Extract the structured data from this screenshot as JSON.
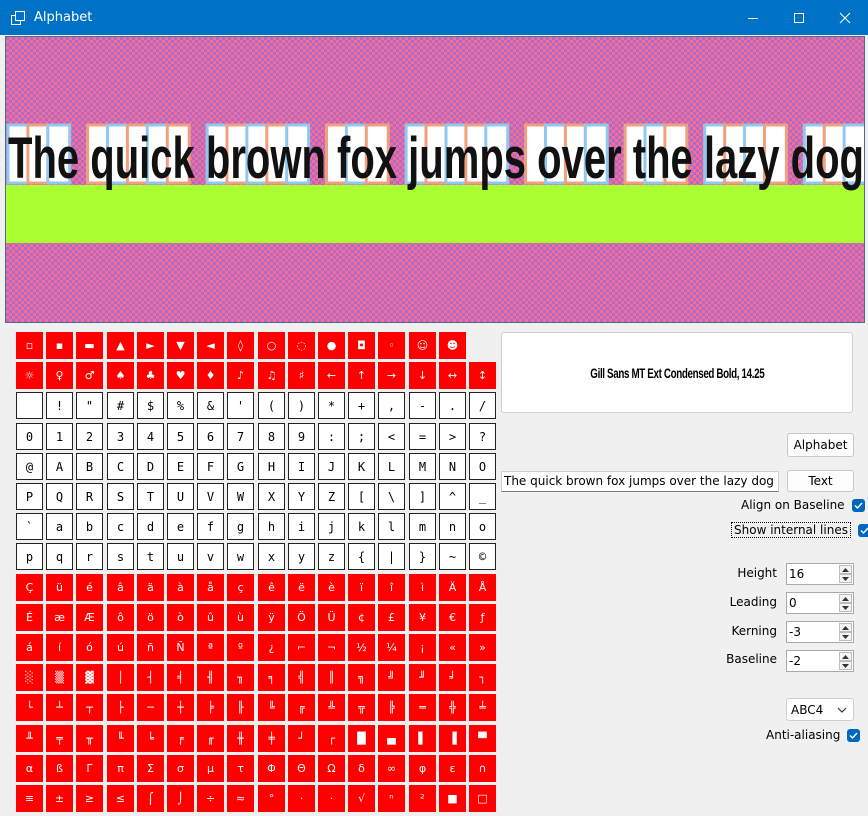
{
  "window": {
    "title": "Alphabet",
    "app_icon": "window-icon",
    "controls": [
      "minimize-icon",
      "maximize-icon",
      "close-icon"
    ]
  },
  "preview": {
    "sample_text": "The quick brown fox jumps over the lazy dog",
    "colors": {
      "checker_a": "#a66dd0",
      "checker_b": "#ff6b8c",
      "baseline_band": "#aaff33",
      "box_blue": "#90c8f0",
      "box_orange": "#f0a080"
    }
  },
  "glyph_grid": {
    "missing_color": "#ff0000",
    "rows": [
      [
        "▫",
        "▪",
        "▬",
        "▲",
        "►",
        "▼",
        "◄",
        "◊",
        "○",
        "◌",
        "●",
        "◘",
        "◦",
        "☺",
        "☻"
      ],
      [
        "☼",
        "♀",
        "♂",
        "♠",
        "♣",
        "♥",
        "♦",
        "♪",
        "♫",
        "♯",
        "←",
        "↑",
        "→",
        "↓",
        "↔",
        "↕"
      ],
      [
        "",
        "!",
        "\"",
        "#",
        "$",
        "%",
        "&",
        "'",
        "(",
        ")",
        "*",
        "+",
        ",",
        "-",
        ".",
        "/"
      ],
      [
        "0",
        "1",
        "2",
        "3",
        "4",
        "5",
        "6",
        "7",
        "8",
        "9",
        ":",
        ";",
        "<",
        "=",
        ">",
        "?"
      ],
      [
        "@",
        "A",
        "B",
        "C",
        "D",
        "E",
        "F",
        "G",
        "H",
        "I",
        "J",
        "K",
        "L",
        "M",
        "N",
        "O"
      ],
      [
        "P",
        "Q",
        "R",
        "S",
        "T",
        "U",
        "V",
        "W",
        "X",
        "Y",
        "Z",
        "[",
        "\\",
        "]",
        "^",
        "_"
      ],
      [
        "`",
        "a",
        "b",
        "c",
        "d",
        "e",
        "f",
        "g",
        "h",
        "i",
        "j",
        "k",
        "l",
        "m",
        "n",
        "o"
      ],
      [
        "p",
        "q",
        "r",
        "s",
        "t",
        "u",
        "v",
        "w",
        "x",
        "y",
        "z",
        "{",
        "|",
        "}",
        "~",
        "©"
      ],
      [
        "Ç",
        "ü",
        "é",
        "â",
        "ä",
        "à",
        "å",
        "ç",
        "ê",
        "ë",
        "è",
        "ï",
        "î",
        "ì",
        "Ä",
        "Å"
      ],
      [
        "É",
        "æ",
        "Æ",
        "ô",
        "ö",
        "ò",
        "û",
        "ù",
        "ÿ",
        "Ö",
        "Ü",
        "¢",
        "£",
        "¥",
        "€",
        "ƒ"
      ],
      [
        "á",
        "í",
        "ó",
        "ú",
        "ñ",
        "Ñ",
        "ª",
        "º",
        "¿",
        "⌐",
        "¬",
        "½",
        "¼",
        "¡",
        "«",
        "»"
      ],
      [
        "░",
        "▒",
        "▓",
        "│",
        "┤",
        "╡",
        "╢",
        "╖",
        "╕",
        "╣",
        "║",
        "╗",
        "╝",
        "╜",
        "╛",
        "┐"
      ],
      [
        "└",
        "┴",
        "┬",
        "├",
        "─",
        "┼",
        "╞",
        "╟",
        "╚",
        "╔",
        "╩",
        "╦",
        "╠",
        "═",
        "╬",
        "╧"
      ],
      [
        "╨",
        "╤",
        "╥",
        "╙",
        "╘",
        "╒",
        "╓",
        "╫",
        "╪",
        "┘",
        "┌",
        "█",
        "▄",
        "▌",
        "▐",
        "▀"
      ],
      [
        "α",
        "ß",
        "Γ",
        "π",
        "Σ",
        "σ",
        "µ",
        "τ",
        "Φ",
        "Θ",
        "Ω",
        "δ",
        "∞",
        "φ",
        "ε",
        "∩"
      ],
      [
        "≡",
        "±",
        "≥",
        "≤",
        "⌠",
        "⌡",
        "÷",
        "≈",
        "°",
        "·",
        "·",
        "√",
        "ⁿ",
        "²",
        "■",
        "□"
      ]
    ],
    "present_rows": [
      2,
      3,
      4,
      5,
      6,
      7
    ]
  },
  "font_panel": {
    "font_name": "Gill Sans MT Ext Condensed Bold, 14.25"
  },
  "controls": {
    "alphabet_button": "Alphabet",
    "sample_text": "The quick brown fox jumps over the lazy dog",
    "text_button": "Text",
    "align_on_baseline": {
      "label": "Align on Baseline",
      "checked": true
    },
    "show_internal_lines": {
      "label": "Show internal lines",
      "checked": true
    },
    "height": {
      "label": "Height",
      "value": "16"
    },
    "leading": {
      "label": "Leading",
      "value": "0"
    },
    "kerning": {
      "label": "Kerning",
      "value": "-3"
    },
    "baseline": {
      "label": "Baseline",
      "value": "-2"
    },
    "encoding": {
      "value": "ABC4"
    },
    "anti_aliasing": {
      "label": "Anti-aliasing",
      "checked": true
    }
  }
}
